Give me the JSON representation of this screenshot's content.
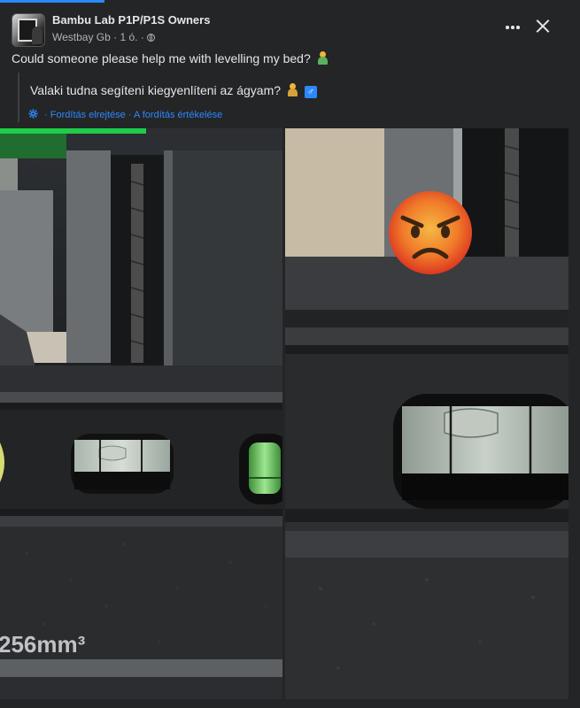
{
  "top_progress": 0.18,
  "post": {
    "group_name": "Bambu Lab P1P/P1S Owners",
    "author": "Westbay Gb",
    "time": "1 ó.",
    "separator": "·",
    "privacy_icon": "globe-icon",
    "text": "Could someone please help me with levelling my bed?",
    "translation": {
      "text": "Valaki tudna segíteni kiegyenlíteni az ágyam?",
      "male_sign": "♂",
      "hide_link": "Fordítás elrejtése",
      "rate_link": "A fordítás értékelése",
      "link_separator": "·"
    },
    "actions": {
      "more_icon": "more-horizontal-icon",
      "close_icon": "close-icon"
    },
    "photos": {
      "left_label": "256mm³",
      "right_overlay": "angry-face-emoji"
    }
  },
  "colors": {
    "background": "#18191a",
    "card": "#242526",
    "text": "#e4e6eb",
    "secondary_text": "#b0b3b8",
    "link": "#2d88ff"
  }
}
